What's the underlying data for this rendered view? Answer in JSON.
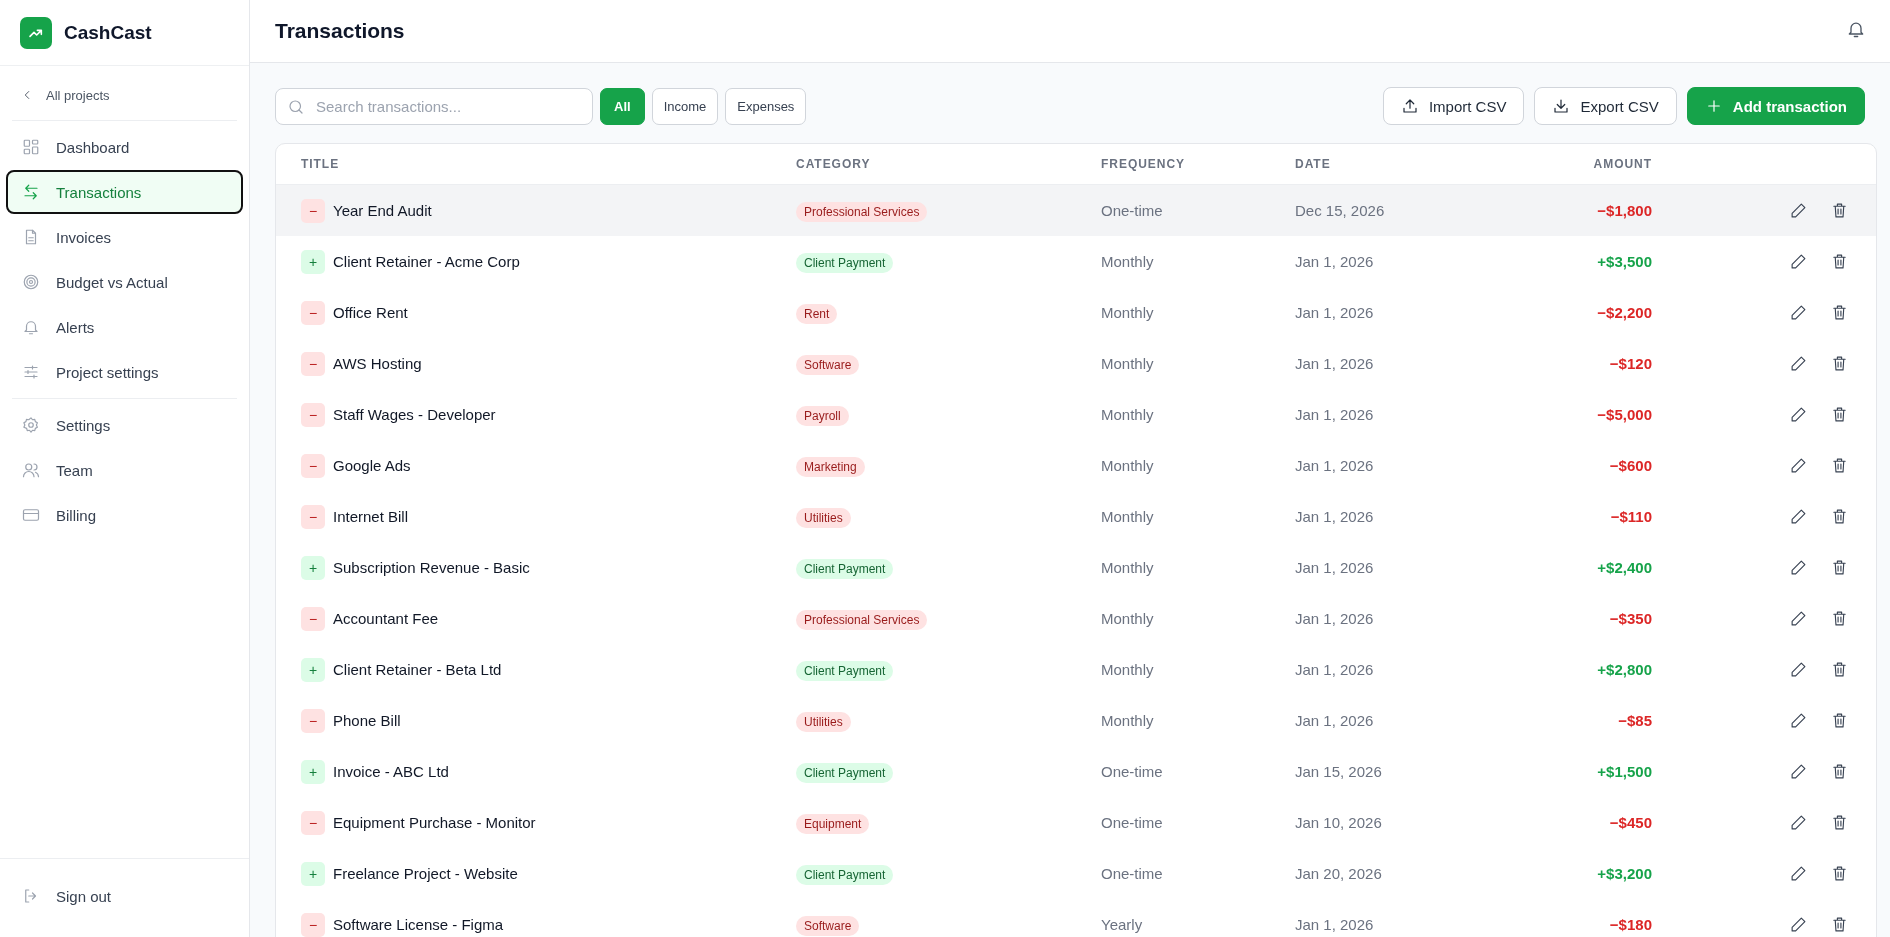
{
  "brand": {
    "name": "CashCast"
  },
  "sidebar": {
    "back_link": "All projects",
    "project_items": [
      {
        "label": "Dashboard",
        "selected": false
      },
      {
        "label": "Transactions",
        "selected": true
      },
      {
        "label": "Invoices",
        "selected": false
      },
      {
        "label": "Budget vs Actual",
        "selected": false
      },
      {
        "label": "Alerts",
        "selected": false
      },
      {
        "label": "Project settings",
        "selected": false
      }
    ],
    "account_items": [
      {
        "label": "Settings",
        "selected": false
      },
      {
        "label": "Team",
        "selected": false
      },
      {
        "label": "Billing",
        "selected": false
      }
    ],
    "sign_out": "Sign out"
  },
  "header": {
    "title": "Transactions"
  },
  "toolbar": {
    "search": {
      "placeholder": "Search transactions..."
    },
    "filters": [
      {
        "label": "All",
        "selected": true
      },
      {
        "label": "Income",
        "selected": false
      },
      {
        "label": "Expenses",
        "selected": false
      }
    ],
    "import_button": "Import CSV",
    "export_button": "Export CSV",
    "add_button": "Add transaction"
  },
  "table": {
    "columns": [
      "TITLE",
      "CATEGORY",
      "FREQUENCY",
      "DATE",
      "AMOUNT"
    ],
    "rows": [
      {
        "kind": "expense",
        "sign": "−",
        "title": "Year End Audit",
        "category": "Professional Services",
        "frequency": "One-time",
        "date": "Dec 15, 2026",
        "amount": "−$1,800",
        "highlighted": true
      },
      {
        "kind": "income",
        "sign": "+",
        "title": "Client Retainer - Acme Corp",
        "category": "Client Payment",
        "frequency": "Monthly",
        "date": "Jan 1, 2026",
        "amount": "+$3,500",
        "highlighted": false
      },
      {
        "kind": "expense",
        "sign": "−",
        "title": "Office Rent",
        "category": "Rent",
        "frequency": "Monthly",
        "date": "Jan 1, 2026",
        "amount": "−$2,200",
        "highlighted": false
      },
      {
        "kind": "expense",
        "sign": "−",
        "title": "AWS Hosting",
        "category": "Software",
        "frequency": "Monthly",
        "date": "Jan 1, 2026",
        "amount": "−$120",
        "highlighted": false
      },
      {
        "kind": "expense",
        "sign": "−",
        "title": "Staff Wages - Developer",
        "category": "Payroll",
        "frequency": "Monthly",
        "date": "Jan 1, 2026",
        "amount": "−$5,000",
        "highlighted": false
      },
      {
        "kind": "expense",
        "sign": "−",
        "title": "Google Ads",
        "category": "Marketing",
        "frequency": "Monthly",
        "date": "Jan 1, 2026",
        "amount": "−$600",
        "highlighted": false
      },
      {
        "kind": "expense",
        "sign": "−",
        "title": "Internet Bill",
        "category": "Utilities",
        "frequency": "Monthly",
        "date": "Jan 1, 2026",
        "amount": "−$110",
        "highlighted": false
      },
      {
        "kind": "income",
        "sign": "+",
        "title": "Subscription Revenue - Basic",
        "category": "Client Payment",
        "frequency": "Monthly",
        "date": "Jan 1, 2026",
        "amount": "+$2,400",
        "highlighted": false
      },
      {
        "kind": "expense",
        "sign": "−",
        "title": "Accountant Fee",
        "category": "Professional Services",
        "frequency": "Monthly",
        "date": "Jan 1, 2026",
        "amount": "−$350",
        "highlighted": false
      },
      {
        "kind": "income",
        "sign": "+",
        "title": "Client Retainer - Beta Ltd",
        "category": "Client Payment",
        "frequency": "Monthly",
        "date": "Jan 1, 2026",
        "amount": "+$2,800",
        "highlighted": false
      },
      {
        "kind": "expense",
        "sign": "−",
        "title": "Phone Bill",
        "category": "Utilities",
        "frequency": "Monthly",
        "date": "Jan 1, 2026",
        "amount": "−$85",
        "highlighted": false
      },
      {
        "kind": "income",
        "sign": "+",
        "title": "Invoice - ABC Ltd",
        "category": "Client Payment",
        "frequency": "One-time",
        "date": "Jan 15, 2026",
        "amount": "+$1,500",
        "highlighted": false
      },
      {
        "kind": "expense",
        "sign": "−",
        "title": "Equipment Purchase - Monitor",
        "category": "Equipment",
        "frequency": "One-time",
        "date": "Jan 10, 2026",
        "amount": "−$450",
        "highlighted": false
      },
      {
        "kind": "income",
        "sign": "+",
        "title": "Freelance Project - Website",
        "category": "Client Payment",
        "frequency": "One-time",
        "date": "Jan 20, 2026",
        "amount": "+$3,200",
        "highlighted": false
      },
      {
        "kind": "expense",
        "sign": "−",
        "title": "Software License - Figma",
        "category": "Software",
        "frequency": "Yearly",
        "date": "Jan 1, 2026",
        "amount": "−$180",
        "highlighted": false
      }
    ]
  }
}
